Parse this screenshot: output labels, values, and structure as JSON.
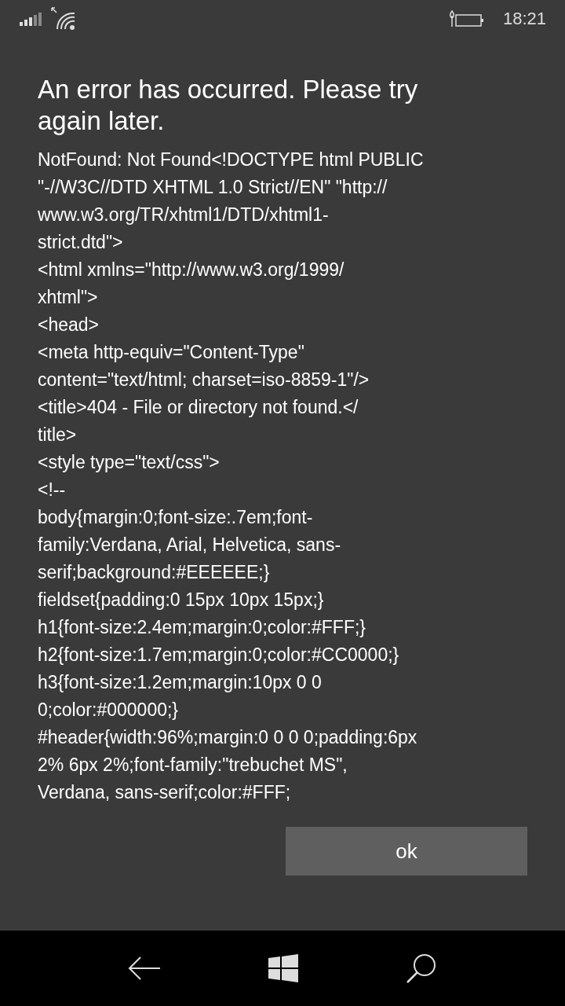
{
  "status_bar": {
    "time": "18:21"
  },
  "dialog": {
    "title": "An error has occurred. Please try again later.",
    "detail_lines": [
      "NotFound: Not Found<!DOCTYPE html PUBLIC",
      "\"-//W3C//DTD XHTML 1.0 Strict//EN\" \"http://",
      "www.w3.org/TR/xhtml1/DTD/xhtml1-",
      "strict.dtd\">",
      "<html xmlns=\"http://www.w3.org/1999/",
      "xhtml\">",
      "<head>",
      "<meta http-equiv=\"Content-Type\"",
      "content=\"text/html; charset=iso-8859-1\"/>",
      "<title>404 - File or directory not found.</",
      "title>",
      "<style type=\"text/css\">",
      "<!--",
      "body{margin:0;font-size:.7em;font-",
      "family:Verdana, Arial, Helvetica, sans-",
      "serif;background:#EEEEEE;}",
      "fieldset{padding:0 15px 10px 15px;}",
      "h1{font-size:2.4em;margin:0;color:#FFF;}",
      "h2{font-size:1.7em;margin:0;color:#CC0000;}",
      "h3{font-size:1.2em;margin:10px 0 0",
      "0;color:#000000;}",
      "#header{width:96%;margin:0 0 0 0;padding:6px",
      "2% 6px 2%;font-family:\"trebuchet MS\",",
      "Verdana, sans-serif;color:#FFF;"
    ],
    "buttons": [
      "ok"
    ]
  }
}
